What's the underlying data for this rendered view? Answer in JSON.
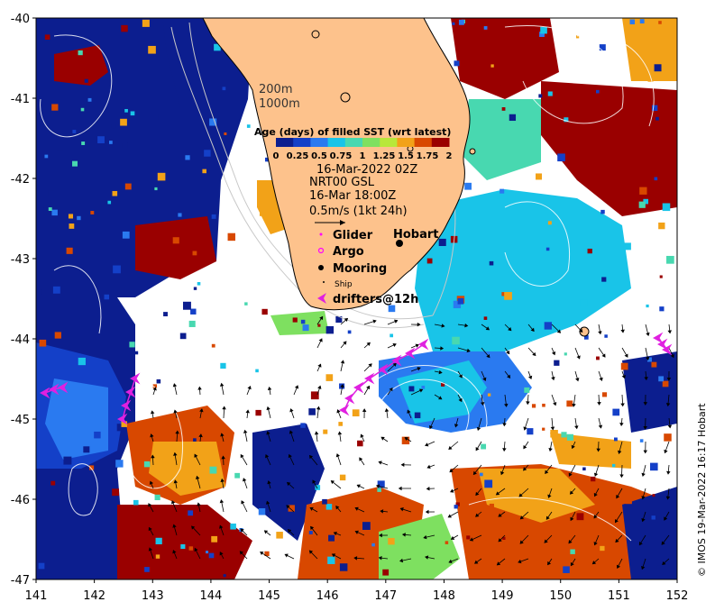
{
  "map": {
    "lon_ticks": [
      "141",
      "142",
      "143",
      "144",
      "145",
      "146",
      "147",
      "148",
      "149",
      "150",
      "151",
      "152"
    ],
    "lat_ticks": [
      "-40",
      "-41",
      "-42",
      "-43",
      "-44",
      "-45",
      "-46",
      "-47"
    ],
    "lon_range": [
      141,
      152
    ],
    "lat_range": [
      -47,
      -40
    ],
    "isobaths": [
      "200m",
      "1000m"
    ],
    "land_color": "#fdc28c",
    "places": [
      {
        "name": "Hobart",
        "lon": 147.33,
        "lat": -42.88
      }
    ]
  },
  "colorbar": {
    "title": "Age (days) of filled SST (wrt latest)",
    "tick_labels": [
      "0",
      "0.25",
      "0.5",
      "0.75",
      "1",
      "1.25",
      "1.5",
      "1.75",
      "2"
    ],
    "colors": [
      "#0c1e8f",
      "#1440c8",
      "#2a7af0",
      "#19c4e8",
      "#48d8b0",
      "#7ee060",
      "#b8e83a",
      "#f2a218",
      "#d84800",
      "#9a0000"
    ]
  },
  "info": {
    "sst_date": "16-Mar-2022 02Z",
    "current_product": "NRT00 GSL",
    "current_date": "16-Mar 18:00Z",
    "vector_scale": "0.5m/s (1kt 24h)"
  },
  "legend": [
    {
      "label": "Glider",
      "symbol": "dot",
      "color": "#ff00ff"
    },
    {
      "label": "Argo",
      "symbol": "circle",
      "color": "#ff00ff"
    },
    {
      "label": "Mooring",
      "symbol": "filled-circle",
      "color": "#000000"
    },
    {
      "label": "Ship",
      "symbol": "small",
      "color": "#000000"
    },
    {
      "label": "drifters@12h",
      "symbol": "arrowhead",
      "color": "#e020e0"
    }
  ],
  "credit": "© IMOS 19-Mar-2022 16:17 Hobart"
}
